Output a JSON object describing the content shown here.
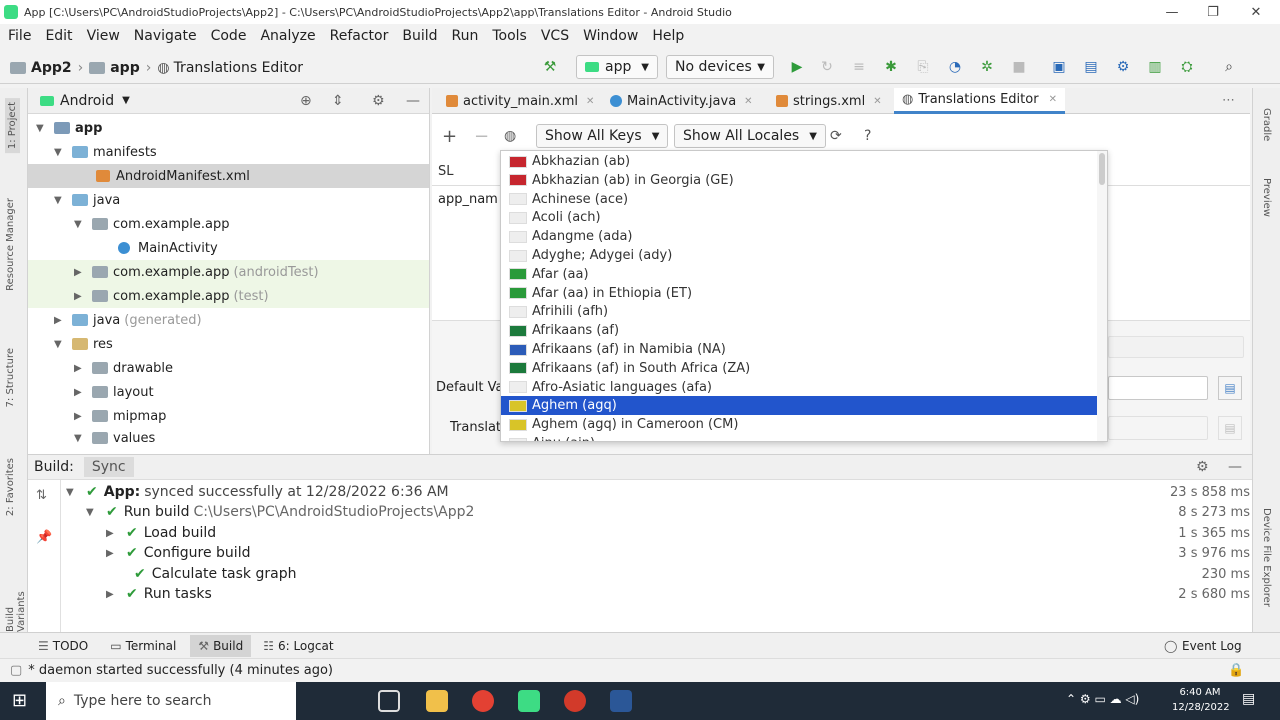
{
  "window": {
    "title": "App [C:\\Users\\PC\\AndroidStudioProjects\\App2] - C:\\Users\\PC\\AndroidStudioProjects\\App2\\app\\Translations Editor - Android Studio",
    "minimize": "—",
    "restore": "❐",
    "close": "✕"
  },
  "menu": [
    "File",
    "Edit",
    "View",
    "Navigate",
    "Code",
    "Analyze",
    "Refactor",
    "Build",
    "Run",
    "Tools",
    "VCS",
    "Window",
    "Help"
  ],
  "breadcrumb": [
    "App2",
    "app",
    "Translations Editor"
  ],
  "run_config": "app",
  "device": "No devices",
  "project_panel": {
    "view": "Android",
    "tree": [
      {
        "label": "app",
        "extra": "",
        "bold": true
      },
      {
        "label": "manifests",
        "extra": ""
      },
      {
        "label": "AndroidManifest.xml",
        "extra": ""
      },
      {
        "label": "java",
        "extra": ""
      },
      {
        "label": "com.example.app",
        "extra": ""
      },
      {
        "label": "MainActivity",
        "extra": ""
      },
      {
        "label": "com.example.app",
        "extra": "(androidTest)"
      },
      {
        "label": "com.example.app",
        "extra": "(test)"
      },
      {
        "label": "java",
        "extra": "(generated)"
      },
      {
        "label": "res",
        "extra": ""
      },
      {
        "label": "drawable",
        "extra": ""
      },
      {
        "label": "layout",
        "extra": ""
      },
      {
        "label": "mipmap",
        "extra": ""
      },
      {
        "label": "values",
        "extra": ""
      }
    ]
  },
  "editor_tabs": [
    "activity_main.xml",
    "MainActivity.java",
    "strings.xml",
    "Translations Editor"
  ],
  "translations": {
    "add": "+",
    "remove": "−",
    "show_keys": "Show All Keys",
    "show_locales": "Show All Locales",
    "help": "?",
    "col_sl": "SL",
    "row_key": "app_nam",
    "default_value_label": "Default Va",
    "translation_label": "Translat"
  },
  "locales": [
    "Abkhazian (ab)",
    "Abkhazian (ab) in Georgia (GE)",
    "Achinese (ace)",
    "Acoli (ach)",
    "Adangme (ada)",
    "Adyghe; Adygei (ady)",
    "Afar (aa)",
    "Afar (aa) in Ethiopia (ET)",
    "Afrihili (afh)",
    "Afrikaans (af)",
    "Afrikaans (af) in Namibia (NA)",
    "Afrikaans (af) in South Africa (ZA)",
    "Afro-Asiatic languages (afa)",
    "Aghem (agq)",
    "Aghem (agq) in Cameroon (CM)",
    "Ainu (ain)"
  ],
  "selected_locale_index": 13,
  "build": {
    "tabs": [
      "Build:",
      "Sync"
    ],
    "rows": [
      {
        "label": "App:",
        "detail": "synced successfully at 12/28/2022 6:36 AM",
        "time": "23 s 858 ms"
      },
      {
        "label": "Run build",
        "detail": "C:\\Users\\PC\\AndroidStudioProjects\\App2",
        "time": "8 s 273 ms"
      },
      {
        "label": "Load build",
        "detail": "",
        "time": "1 s 365 ms"
      },
      {
        "label": "Configure build",
        "detail": "",
        "time": "3 s 976 ms"
      },
      {
        "label": "Calculate task graph",
        "detail": "",
        "time": "230 ms"
      },
      {
        "label": "Run tasks",
        "detail": "",
        "time": "2 s 680 ms"
      }
    ]
  },
  "bottom_tools": [
    "TODO",
    "Terminal",
    "Build",
    "6: Logcat"
  ],
  "event_log": "Event Log",
  "status": "* daemon started successfully (4 minutes ago)",
  "left_tabs": [
    "1: Project",
    "Resource Manager",
    "7: Structure",
    "2: Favorites",
    "Build Variants"
  ],
  "right_tabs": [
    "Gradle",
    "Preview",
    "Device File Explorer"
  ],
  "taskbar": {
    "search_placeholder": "Type here to search",
    "time": "6:40 AM",
    "date": "12/28/2022"
  }
}
